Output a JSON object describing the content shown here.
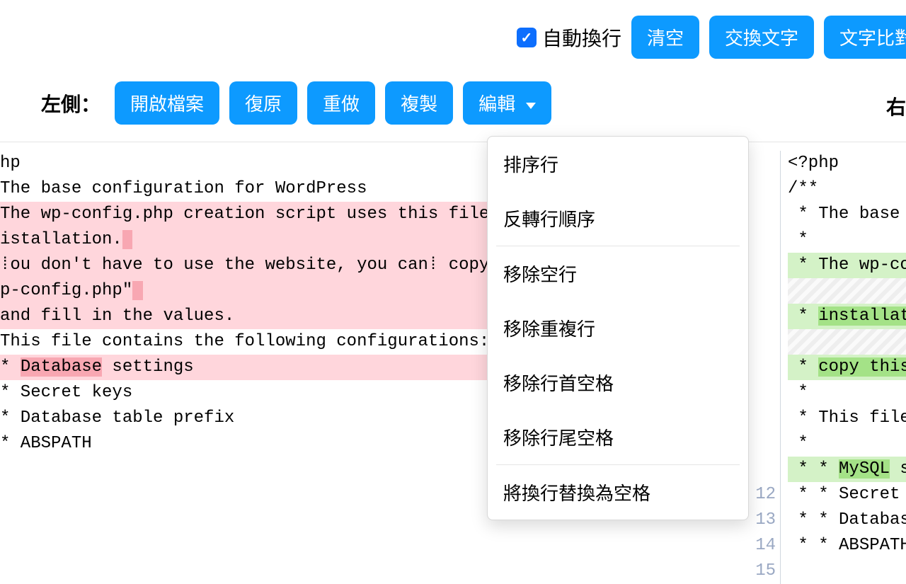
{
  "topbar": {
    "autowrap_label": "自動換行",
    "clear": "清空",
    "swap": "交換文字",
    "compare": "文字比對"
  },
  "toolbar": {
    "left_label": "左側：",
    "right_label": "右",
    "open_file": "開啟檔案",
    "undo": "復原",
    "redo": "重做",
    "copy": "複製",
    "edit": "編輯"
  },
  "edit_menu": {
    "sort": "排序行",
    "reverse": "反轉行順序",
    "remove_blank": "移除空行",
    "remove_dup": "移除重複行",
    "trim_leading": "移除行首空格",
    "trim_trailing": "移除行尾空格",
    "join": "將換行替換為空格"
  },
  "left_lines": [
    {
      "text": "hp",
      "del": false
    },
    {
      "text": "",
      "del": false
    },
    {
      "text": "The base configuration for WordPress",
      "del": false
    },
    {
      "text": "",
      "del": false
    },
    {
      "text": "The wp-config.php creation script uses this file during the",
      "del": true,
      "hl_tail": ""
    },
    {
      "pre": "istallation.",
      "tail": " ",
      "del": true,
      "hl_tail": true
    },
    {
      "text": "⁞ou don't have to use the website, you can⁞ copy this file to",
      "del": true
    },
    {
      "pre": "p-config.php\"",
      "tail": " ",
      "del": true,
      "hl_tail": true
    },
    {
      "text": "and fill in the values.",
      "del": true
    },
    {
      "text": "",
      "del": false
    },
    {
      "text": "This file contains the following configurations:",
      "del": false
    },
    {
      "text": "",
      "del": false
    },
    {
      "pre": "* ",
      "strong": "Database",
      "post": " settings",
      "del": true,
      "hl_strong": true
    },
    {
      "text": "* Secret keys",
      "del": false
    },
    {
      "text": "* Database table prefix",
      "del": false
    },
    {
      "text": "* ABSPATH",
      "del": false
    }
  ],
  "right_marks": [
    "",
    "",
    "",
    "",
    "+",
    "",
    "+",
    "",
    "+",
    "",
    "",
    "",
    "+",
    "",
    "",
    "",
    ""
  ],
  "right_nums": [
    "",
    "",
    "",
    "",
    "",
    "",
    "",
    "",
    "",
    "",
    "",
    "",
    "",
    "12",
    "13",
    "14",
    "15"
  ],
  "right_lines": [
    {
      "text": "<?php",
      "cls": ""
    },
    {
      "text": "/**",
      "cls": ""
    },
    {
      "text": " * The base c",
      "cls": ""
    },
    {
      "text": " *",
      "cls": ""
    },
    {
      "text": " * The wp-con",
      "cls": "add"
    },
    {
      "text": "",
      "cls": "hatch"
    },
    {
      "pre": " * ",
      "strong": "installati",
      "cls": "add"
    },
    {
      "text": "",
      "cls": "hatch"
    },
    {
      "pre": " * ",
      "strong": "copy this ",
      "cls": "add"
    },
    {
      "text": " *",
      "cls": ""
    },
    {
      "text": " * This file",
      "cls": ""
    },
    {
      "text": " *",
      "cls": ""
    },
    {
      "pre": " * * ",
      "strong": "MySQL",
      "post": " se",
      "cls": "add"
    },
    {
      "text": " * * Secret k",
      "cls": ""
    },
    {
      "text": " * * Database",
      "cls": ""
    },
    {
      "text": " * * ABSPATH",
      "cls": ""
    },
    {
      "text": "",
      "cls": ""
    }
  ]
}
